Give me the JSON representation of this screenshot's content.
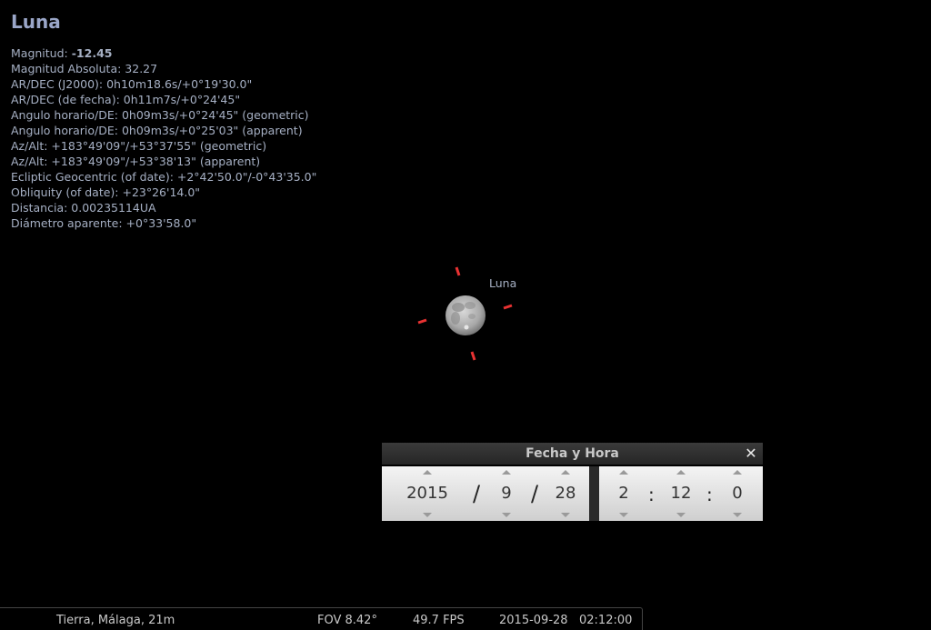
{
  "object_info": {
    "title": "Luna",
    "magnitude_label": "Magnitud:",
    "magnitude_value": "-12.45",
    "lines": [
      "Magnitud Absoluta: 32.27",
      "AR/DEC (J2000): 0h10m18.6s/+0°19'30.0\"",
      "AR/DEC (de fecha): 0h11m7s/+0°24'45\"",
      "Angulo horario/DE: 0h09m3s/+0°24'45\" (geometric)",
      "Angulo horario/DE: 0h09m3s/+0°25'03\" (apparent)",
      "Az/Alt: +183°49'09\"/+53°37'55\" (geometric)",
      "Az/Alt: +183°49'09\"/+53°38'13\" (apparent)",
      "Ecliptic Geocentric (of date): +2°42'50.0\"/-0°43'35.0\"",
      "Obliquity (of date): +23°26'14.0\"",
      "Distancia: 0.00235114UA",
      "Diámetro aparente: +0°33'58.0\""
    ]
  },
  "sky": {
    "object_label": "Luna",
    "marker_color": "#e83232"
  },
  "datetime_dialog": {
    "title": "Fecha y Hora",
    "year": "2015",
    "month": "9",
    "day": "28",
    "hour": "2",
    "minute": "12",
    "second": "0",
    "date_separator": "/",
    "time_separator": ":"
  },
  "status_bar": {
    "location": "Tierra, Málaga, 21m",
    "fov": "FOV 8.42°",
    "fps": "49.7 FPS",
    "date": "2015-09-28",
    "time": "02:12:00"
  }
}
